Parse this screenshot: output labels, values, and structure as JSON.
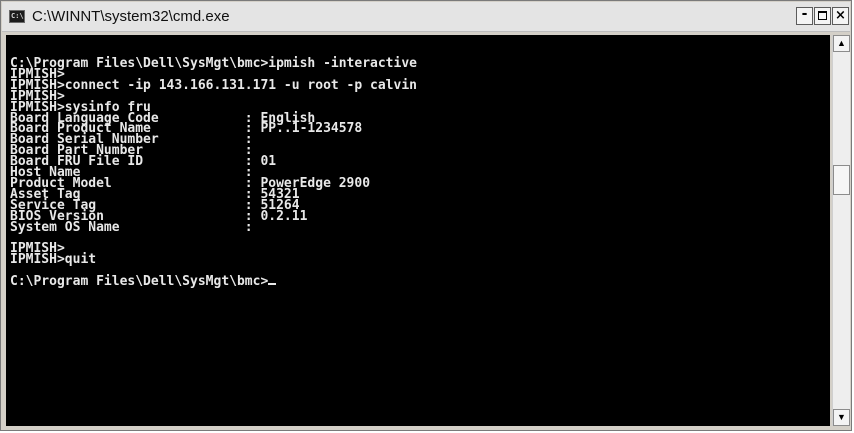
{
  "window": {
    "title": "C:\\WINNT\\system32\\cmd.exe",
    "icon": "cmd-console-icon",
    "controls": {
      "minimize": "-",
      "close": "×"
    }
  },
  "console": {
    "text": "C:\\Program Files\\Dell\\SysMgt\\bmc>ipmish -interactive\nIPMISH>\nIPMISH>connect -ip 143.166.131.171 -u root -p calvin\nIPMISH>\nIPMISH>sysinfo fru\nBoard Language Code           : English\nBoard Product Name            : PP..1-1234578\nBoard Serial Number           :\nBoard Part Number             :\nBoard FRU File ID             : 01\nHost Name                     :\nProduct Model                 : PowerEdge 2900\nAsset Tag                     : 54321\nService Tag                   : 51264\nBIOS Version                  : 0.2.11\nSystem OS Name                :\n\nIPMISH>\nIPMISH>quit\n\nC:\\Program Files\\Dell\\SysMgt\\bmc>"
  },
  "scrollbar": {
    "up_arrow": "▲",
    "down_arrow": "▼"
  },
  "colors": {
    "console_bg": "#000000",
    "console_fg": "#e8e8e8",
    "titlebar_bg": "#e4e4e4"
  }
}
